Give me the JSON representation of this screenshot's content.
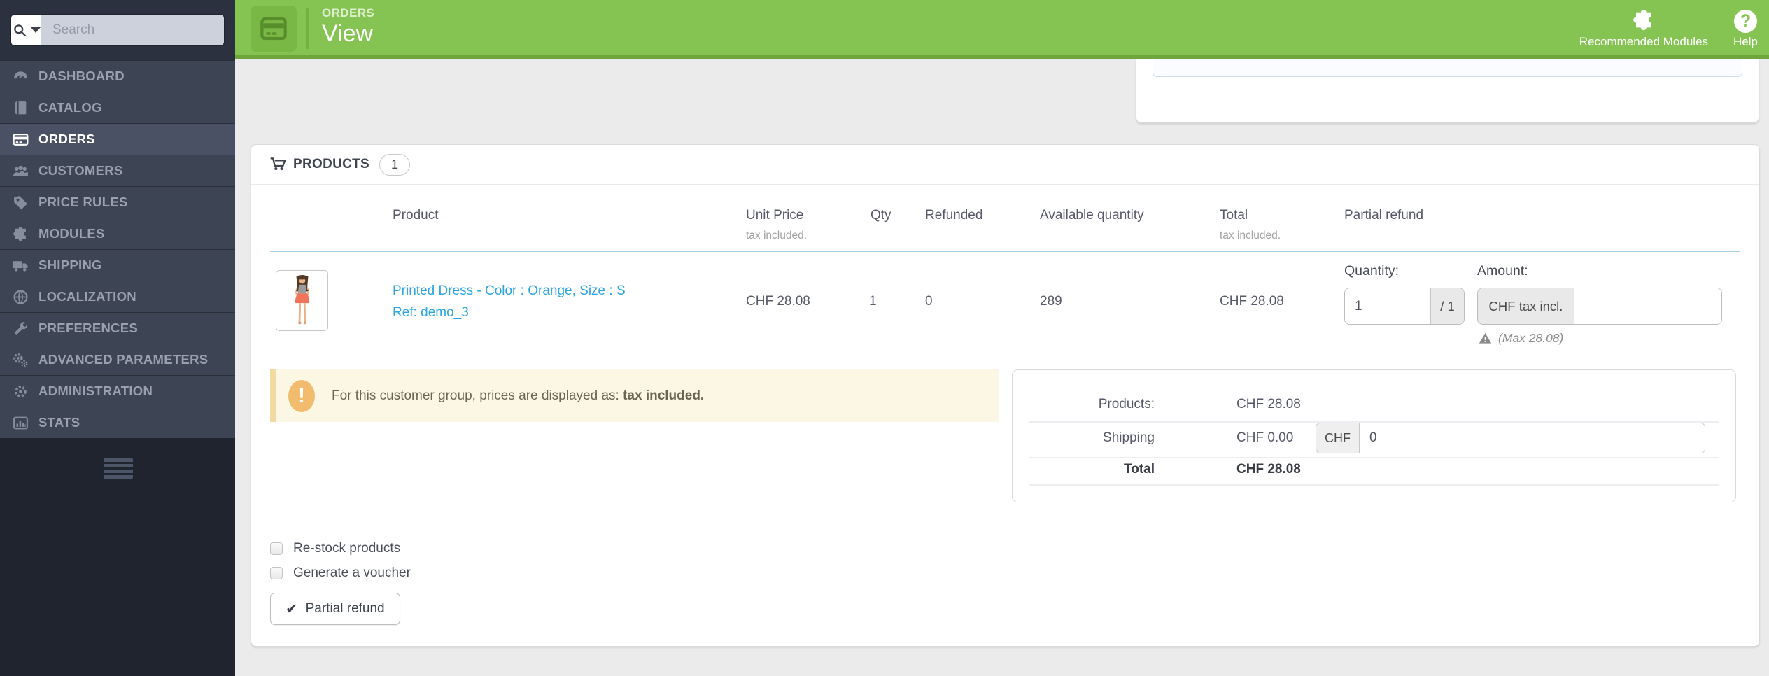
{
  "sidebar": {
    "search": {
      "placeholder": "Search"
    },
    "items": [
      {
        "label": "DASHBOARD",
        "icon": "dashboard-icon",
        "active": false
      },
      {
        "label": "CATALOG",
        "icon": "catalog-icon",
        "active": false
      },
      {
        "label": "ORDERS",
        "icon": "orders-icon",
        "active": true
      },
      {
        "label": "CUSTOMERS",
        "icon": "customers-icon",
        "active": false
      },
      {
        "label": "PRICE RULES",
        "icon": "price-rules-icon",
        "active": false
      },
      {
        "label": "MODULES",
        "icon": "modules-icon",
        "active": false
      },
      {
        "label": "SHIPPING",
        "icon": "shipping-icon",
        "active": false
      },
      {
        "label": "LOCALIZATION",
        "icon": "localization-icon",
        "active": false
      },
      {
        "label": "PREFERENCES",
        "icon": "preferences-icon",
        "active": false
      },
      {
        "label": "ADVANCED PARAMETERS",
        "icon": "advanced-parameters-icon",
        "active": false
      },
      {
        "label": "ADMINISTRATION",
        "icon": "administration-icon",
        "active": false
      },
      {
        "label": "STATS",
        "icon": "stats-icon",
        "active": false
      }
    ]
  },
  "header": {
    "breadcrumb": "ORDERS",
    "title": "View",
    "actions": [
      {
        "label": "Recommended Modules",
        "icon": "puzzle-icon"
      },
      {
        "label": "Help",
        "icon": "help-icon"
      }
    ]
  },
  "icons": {
    "help_glyph": "?",
    "notice_glyph": "!",
    "check_glyph": "✔"
  },
  "products_panel": {
    "title": "PRODUCTS",
    "count": "1",
    "table": {
      "columns": [
        {
          "label": "Product",
          "sub": ""
        },
        {
          "label": "Unit Price",
          "sub": "tax included."
        },
        {
          "label": "Qty",
          "sub": ""
        },
        {
          "label": "Refunded",
          "sub": ""
        },
        {
          "label": "Available quantity",
          "sub": ""
        },
        {
          "label": "Total",
          "sub": "tax included."
        },
        {
          "label": "Partial refund",
          "sub": ""
        }
      ],
      "row": {
        "name": "Printed Dress - Color : Orange, Size : S",
        "ref": "Ref: demo_3",
        "unit_price": "CHF 28.08",
        "qty": "1",
        "refunded": "0",
        "available_quantity": "289",
        "total": "CHF 28.08"
      }
    },
    "partial_refund": {
      "quantity_label": "Quantity:",
      "quantity_value": "1",
      "quantity_addon": "/ 1",
      "amount_label": "Amount:",
      "amount_addon": "CHF tax incl.",
      "amount_value": "",
      "max_note": "(Max 28.08)"
    },
    "notice": {
      "text_prefix": "For this customer group, prices are displayed as: ",
      "text_bold": "tax included."
    },
    "totals": {
      "products_label": "Products:",
      "products_value": "CHF 28.08",
      "shipping_label": "Shipping",
      "shipping_value": "CHF 0.00",
      "shipping_input_addon": "CHF",
      "shipping_input_value": "0",
      "total_label": "Total",
      "total_value": "CHF 28.08"
    },
    "options": [
      {
        "label": "Re-stock products",
        "checked": false
      },
      {
        "label": "Generate a voucher",
        "checked": false
      }
    ],
    "submit_label": "Partial refund"
  },
  "colors": {
    "header_green": "#85c452",
    "header_green_dark": "#6ea53c",
    "sidebar_item": "#3d4453",
    "sidebar_active": "#4a5165",
    "link_blue": "#2da5e0",
    "table_header_underline": "#a6d0e9",
    "notice_bg": "#fcf7e5",
    "notice_accent": "#f1bc6d",
    "content_bg": "#ebebeb"
  }
}
